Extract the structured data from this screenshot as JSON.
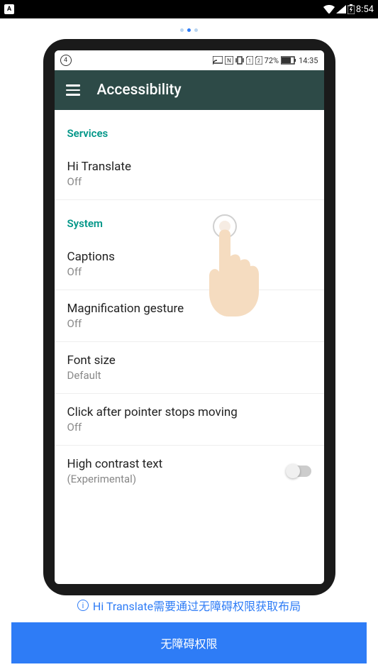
{
  "outer_status": {
    "left_badge": "A",
    "time": "8:54"
  },
  "dots": {
    "count": 3,
    "active": 1
  },
  "inner_status": {
    "sim": "4",
    "battery": "72%",
    "time": "14:35"
  },
  "appbar": {
    "title": "Accessibility"
  },
  "sections": {
    "services": {
      "label": "Services",
      "items": [
        {
          "title": "Hi Translate",
          "sub": "Off"
        }
      ]
    },
    "system": {
      "label": "System",
      "items": [
        {
          "title": "Captions",
          "sub": "Off"
        },
        {
          "title": "Magnification gesture",
          "sub": "Off"
        },
        {
          "title": "Font size",
          "sub": "Default"
        },
        {
          "title": "Click after pointer stops moving",
          "sub": "Off"
        },
        {
          "title": "High contrast text",
          "sub": "(Experimental)",
          "has_toggle": true
        }
      ]
    }
  },
  "info_message": "Hi Translate需要通过无障碍权限获取布局",
  "button_label": "无障碍权限"
}
